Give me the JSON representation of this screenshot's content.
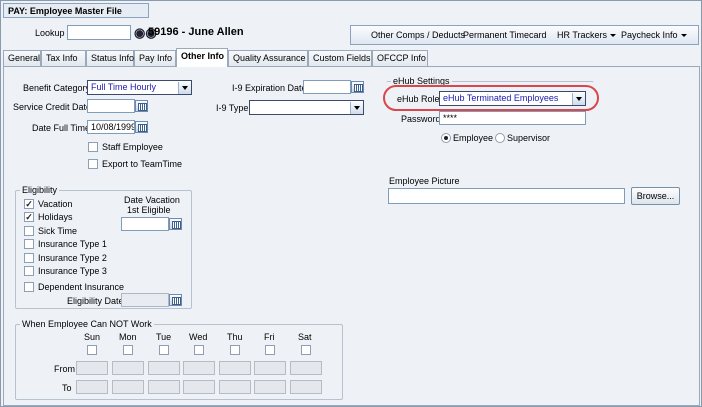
{
  "window": {
    "title": "PAY: Employee Master File"
  },
  "header": {
    "lookup_label": "Lookup",
    "lookup_value": "",
    "employee_display": "59196 - June Allen"
  },
  "toolbar": {
    "other_comps": "Other Comps / Deducts",
    "permanent_timecard": "Permanent Timecard",
    "hr_trackers": "HR Trackers",
    "paycheck_info": "Paycheck Info"
  },
  "tabs": [
    {
      "label": "General"
    },
    {
      "label": "Tax Info"
    },
    {
      "label": "Status Info"
    },
    {
      "label": "Pay Info"
    },
    {
      "label": "Other Info"
    },
    {
      "label": "Quality Assurance"
    },
    {
      "label": "Custom Fields"
    },
    {
      "label": "OFCCP Info"
    }
  ],
  "form": {
    "benefit_category_label": "Benefit Category",
    "benefit_category_value": "Full Time Hourly",
    "service_credit_label": "Service Credit Date",
    "service_credit_value": "",
    "date_full_time_label": "Date Full Time",
    "date_full_time_value": "10/08/1999",
    "staff_employee_label": "Staff Employee",
    "export_teamtime_label": "Export to TeamTime",
    "i9_exp_label": "I-9 Expiration Date",
    "i9_exp_value": "",
    "i9_type_label": "I-9 Type",
    "i9_type_value": ""
  },
  "ehub": {
    "title": "eHub Settings",
    "role_label": "eHub Role",
    "role_value": "eHub Terminated Employees",
    "password_label": "Password",
    "password_value": "****",
    "employee_label": "Employee",
    "supervisor_label": "Supervisor"
  },
  "picture": {
    "label": "Employee Picture",
    "path_value": "",
    "browse_label": "Browse..."
  },
  "eligibility": {
    "title": "Eligibility",
    "items": [
      {
        "label": "Vacation",
        "checked": "✓"
      },
      {
        "label": "Holidays",
        "checked": "✓"
      },
      {
        "label": "Sick Time",
        "checked": ""
      },
      {
        "label": "Insurance Type 1",
        "checked": ""
      },
      {
        "label": "Insurance Type 2",
        "checked": ""
      },
      {
        "label": "Insurance Type 3",
        "checked": ""
      }
    ],
    "dependent_label": "Dependent Insurance",
    "date_vacation_label1": "Date Vacation",
    "date_vacation_label2": "1st Eligible",
    "date_vacation_value": "",
    "eligibility_date_label": "Eligibility Date",
    "eligibility_date_value": ""
  },
  "cannot_work": {
    "title": "When Employee Can NOT Work",
    "days": [
      "Sun",
      "Mon",
      "Tue",
      "Wed",
      "Thu",
      "Fri",
      "Sat"
    ],
    "from_label": "From",
    "to_label": "To"
  }
}
